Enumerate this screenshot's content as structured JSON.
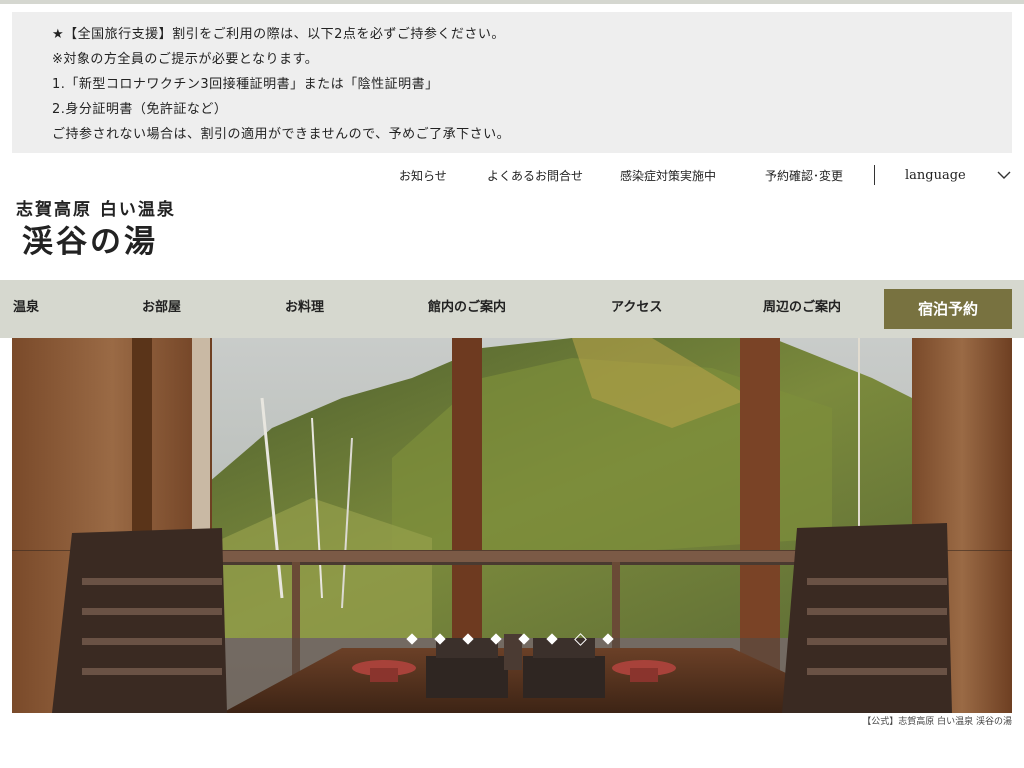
{
  "notice": {
    "lines": [
      "★【全国旅行支援】割引をご利用の際は、以下2点を必ずご持参ください。",
      "※対象の方全員のご提示が必要となります。",
      "1.「新型コロナワクチン3回接種証明書」または「陰性証明書」",
      "2.身分証明書（免許証など）",
      "ご持参されない場合は、割引の適用ができませんので、予めご了承下さい。"
    ]
  },
  "utility_nav": {
    "items": [
      "お知らせ",
      "よくあるお問合せ",
      "感染症対策実施中",
      "予約確認･変更"
    ],
    "language_label": "language",
    "language_icon": "chevron-down-icon"
  },
  "logo": {
    "subtitle": "志賀高原 白い温泉",
    "title": "渓谷の湯"
  },
  "main_nav": {
    "items": [
      "温泉",
      "お部屋",
      "お料理",
      "館内のご案内",
      "アクセス",
      "周辺のご案内"
    ],
    "booking_label": "宿泊予約"
  },
  "colors": {
    "nav_background": "#d6d8cf",
    "booking_button": "#787240",
    "notice_background": "#eeeeee"
  },
  "hero": {
    "slide_count": 8,
    "active_slide_number": 7
  },
  "footer": {
    "caption": "【公式】志賀高原 白い温泉 渓谷の湯"
  }
}
